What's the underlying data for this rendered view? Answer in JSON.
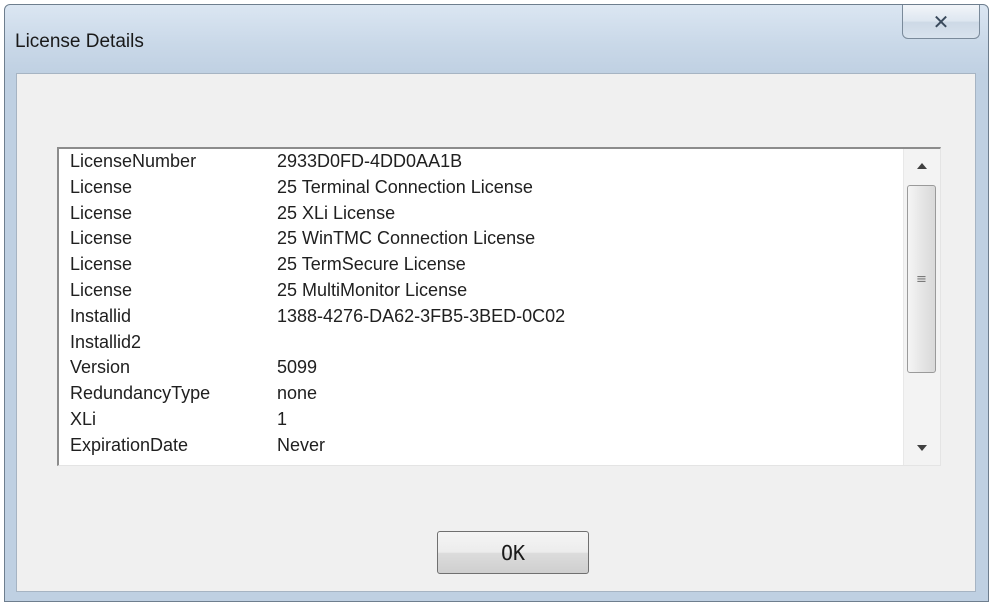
{
  "window": {
    "title": "License Details",
    "close_glyph": "✕"
  },
  "list": {
    "rows": [
      {
        "key": "LicenseNumber",
        "value": "2933D0FD-4DD0AA1B"
      },
      {
        "key": "License",
        "value": "25 Terminal Connection License"
      },
      {
        "key": "License",
        "value": "25 XLi License"
      },
      {
        "key": "License",
        "value": "25 WinTMC Connection License"
      },
      {
        "key": "License",
        "value": "25 TermSecure License"
      },
      {
        "key": "License",
        "value": "25 MultiMonitor License"
      },
      {
        "key": "Installid",
        "value": "1388-4276-DA62-3FB5-3BED-0C02"
      },
      {
        "key": "Installid2",
        "value": ""
      },
      {
        "key": "Version",
        "value": "5099"
      },
      {
        "key": "RedundancyType",
        "value": "none"
      },
      {
        "key": "XLi",
        "value": "1"
      },
      {
        "key": "ExpirationDate",
        "value": "Never"
      }
    ]
  },
  "scrollbar": {
    "up_icon": "up-arrow",
    "down_icon": "down-arrow",
    "grip": "≡"
  },
  "buttons": {
    "ok_label": "OK"
  }
}
